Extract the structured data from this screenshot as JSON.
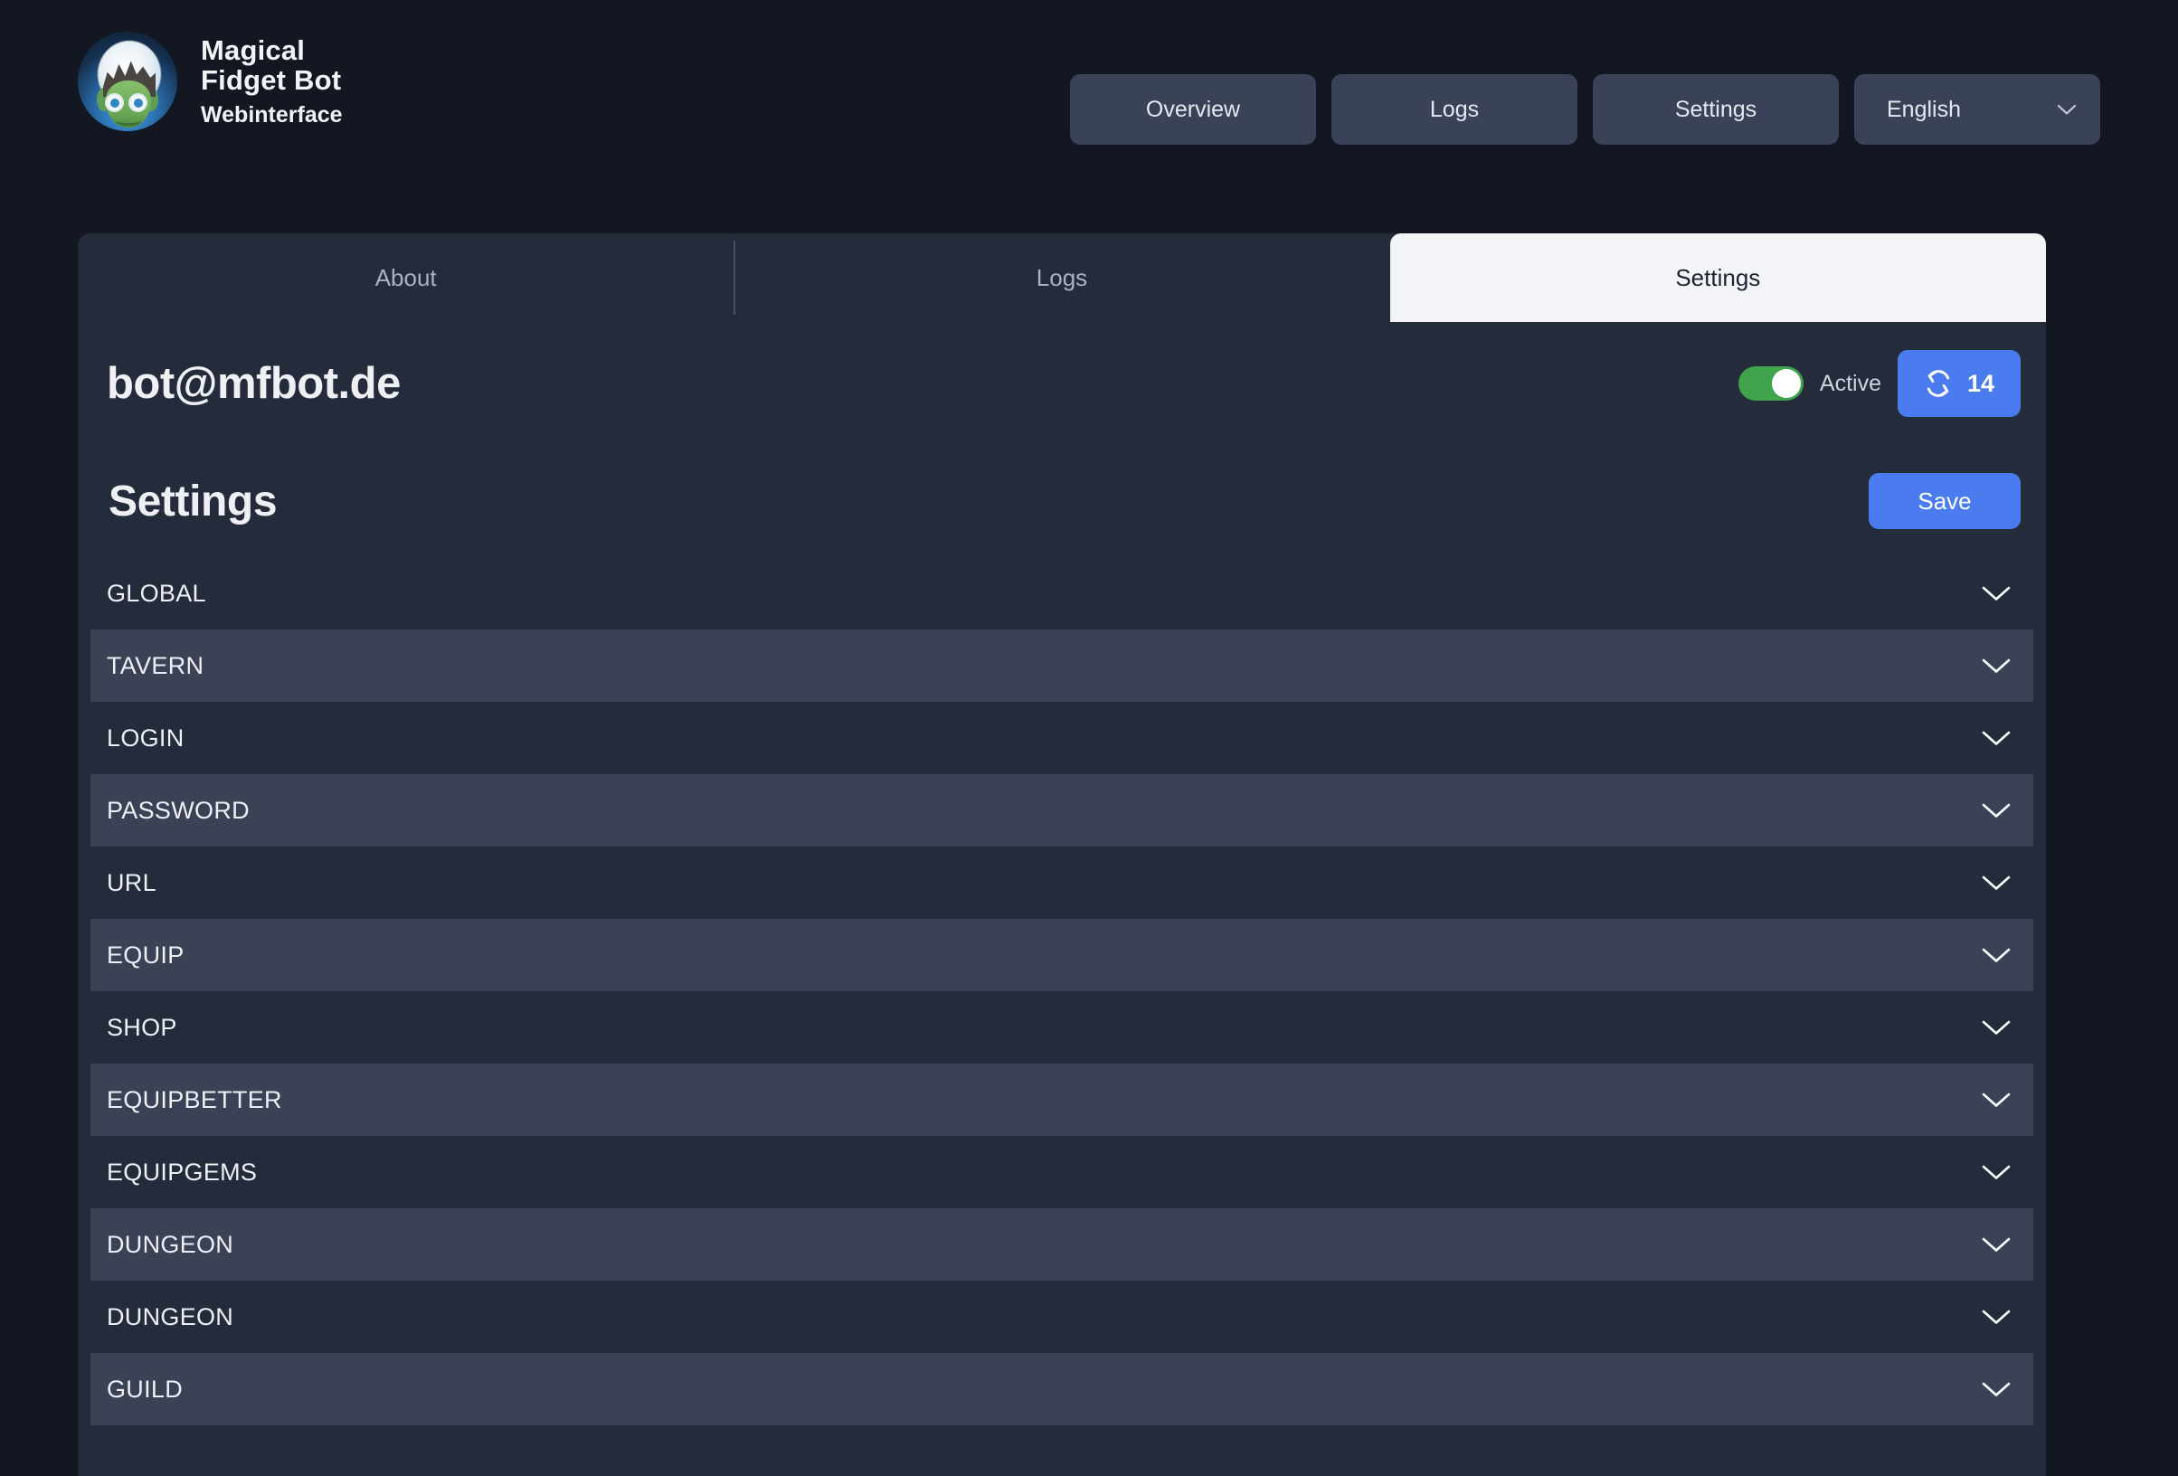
{
  "brand": {
    "logo_icon": "bot-avatar-icon",
    "name_line1": "Magical",
    "name_line2": "Fidget Bot",
    "subtitle": "Webinterface"
  },
  "header_nav": {
    "buttons": [
      {
        "label": "Overview",
        "name": "nav-overview"
      },
      {
        "label": "Logs",
        "name": "nav-logs"
      },
      {
        "label": "Settings",
        "name": "nav-settings"
      }
    ],
    "language_select": {
      "value": "English",
      "chevron_icon": "chevron-down-icon"
    }
  },
  "tabs": [
    {
      "label": "About",
      "active": false
    },
    {
      "label": "Logs",
      "active": false
    },
    {
      "label": "Settings",
      "active": true
    }
  ],
  "account": {
    "email": "bot@mfbot.de",
    "toggle_state": "on",
    "status_label": "Active",
    "refresh": {
      "icon": "refresh-sync-icon",
      "count": "14"
    }
  },
  "settings": {
    "title": "Settings",
    "save_label": "Save",
    "sections": [
      {
        "label": "GLOBAL",
        "expanded": false
      },
      {
        "label": "TAVERN",
        "expanded": false
      },
      {
        "label": "LOGIN",
        "expanded": false
      },
      {
        "label": "PASSWORD",
        "expanded": false
      },
      {
        "label": "URL",
        "expanded": false
      },
      {
        "label": "EQUIP",
        "expanded": false
      },
      {
        "label": "SHOP",
        "expanded": false
      },
      {
        "label": "EQUIPBETTER",
        "expanded": false
      },
      {
        "label": "EQUIPGEMS",
        "expanded": false
      },
      {
        "label": "DUNGEON",
        "expanded": false
      },
      {
        "label": "DUNGEON",
        "expanded": false
      },
      {
        "label": "GUILD",
        "expanded": false
      }
    ]
  },
  "colors": {
    "page_bg": "#131722",
    "card_bg": "#242b3a",
    "row_alt_bg": "#3b4256",
    "nav_btn_bg": "#3a4257",
    "accent_blue": "#4a7cf0",
    "toggle_green": "#3fa34d",
    "active_tab_bg": "#f3f4f7",
    "text_primary": "#eef0f4",
    "text_muted": "#a9b1c2"
  }
}
